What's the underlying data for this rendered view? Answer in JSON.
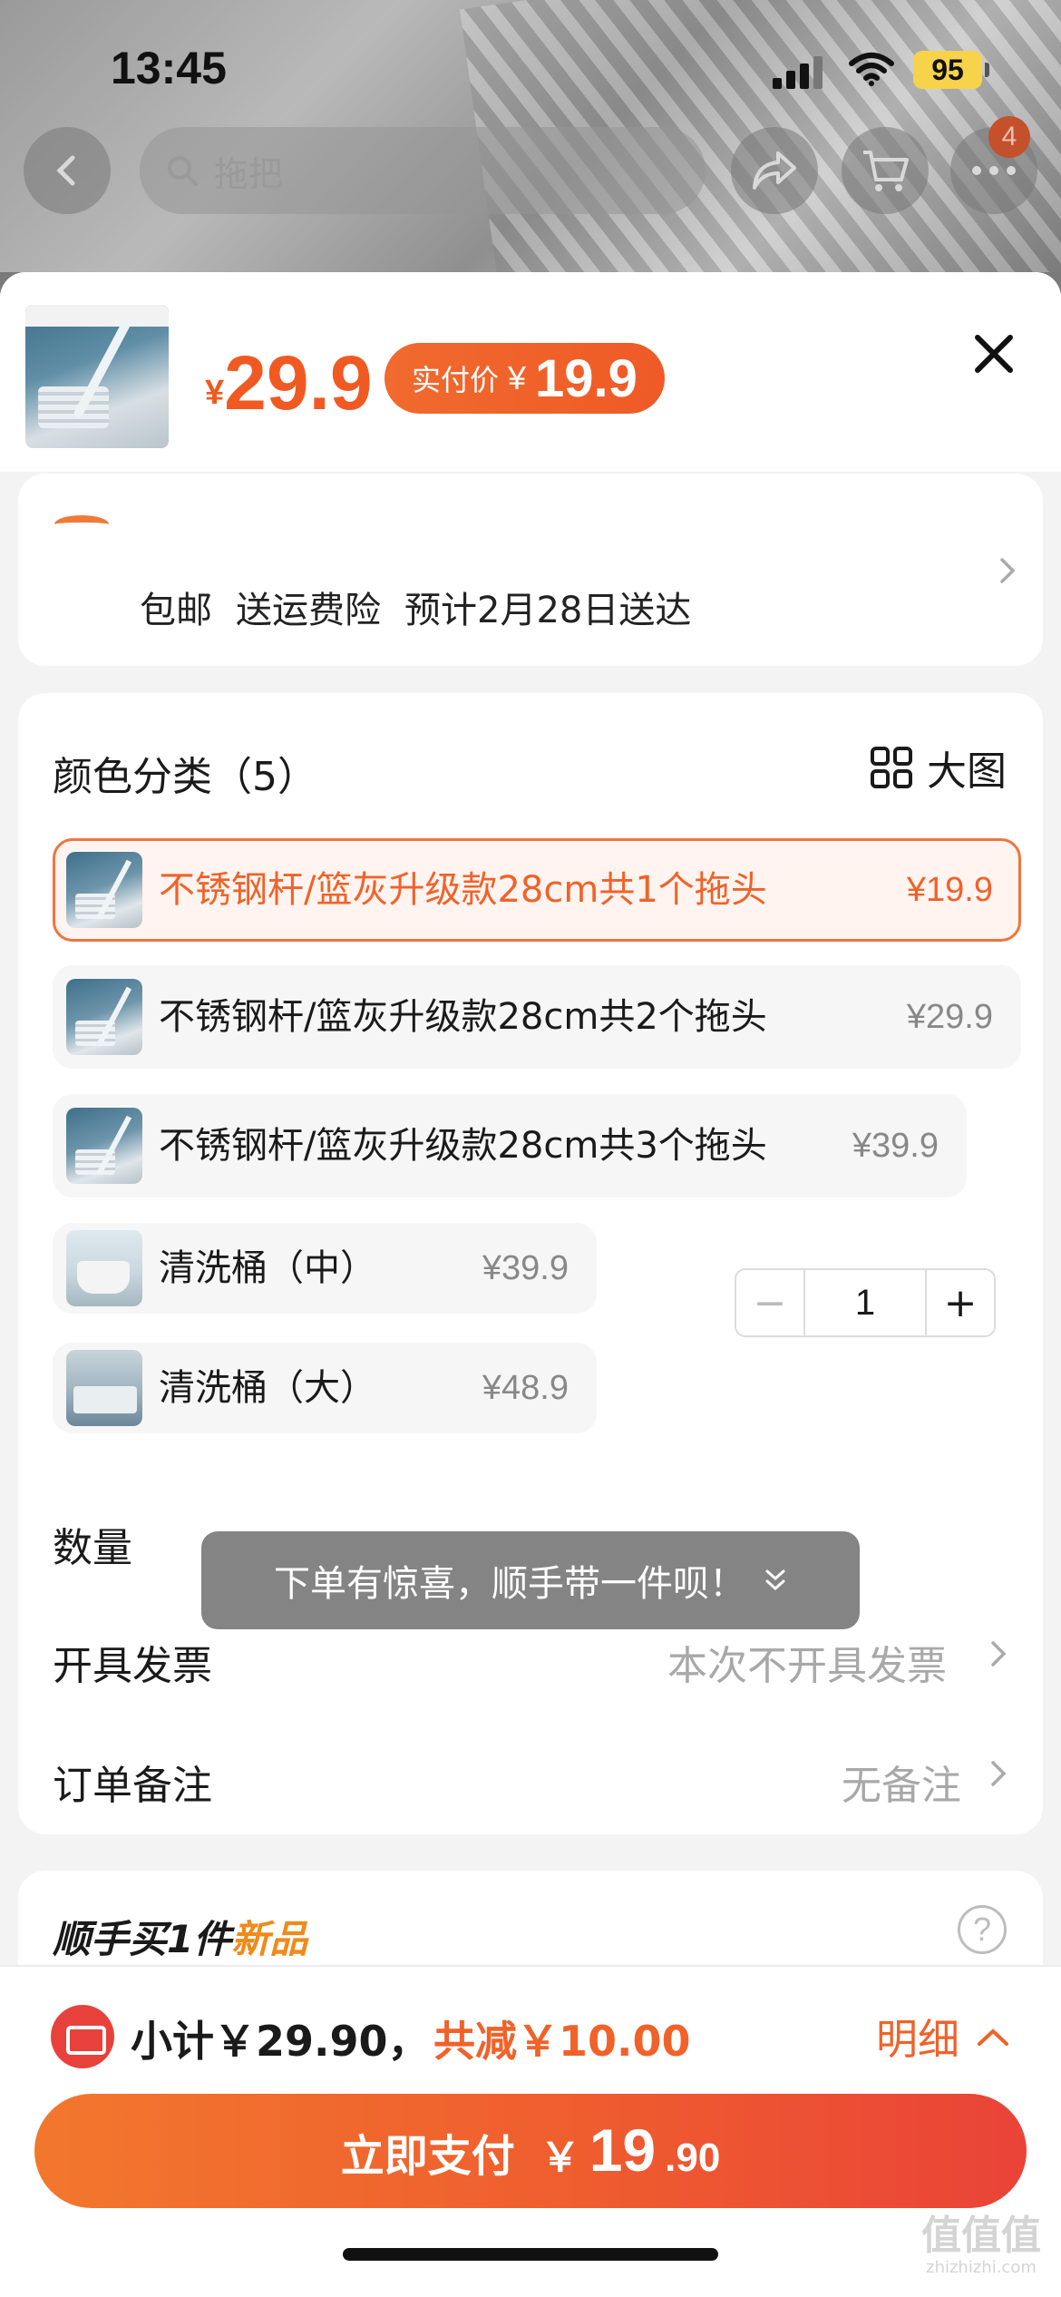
{
  "status_bar": {
    "time": "13:45",
    "battery": "95"
  },
  "background": {
    "search_placeholder": "拖把",
    "cart_badge": "4"
  },
  "product": {
    "price_symbol": "¥",
    "price": "29.9",
    "paid_label": "实付价",
    "paid_symbol": "¥",
    "paid_price": "19.9"
  },
  "delivery": {
    "tags": [
      "包邮",
      "送运费险",
      "预计2月28日送达"
    ]
  },
  "options": {
    "title": "颜色分类（5）",
    "big_picture": "大图",
    "items": [
      {
        "label": "不锈钢杆/篮灰升级款28cm共1个拖头",
        "price": "¥19.9",
        "selected": true
      },
      {
        "label": "不锈钢杆/篮灰升级款28cm共2个拖头",
        "price": "¥29.9",
        "selected": false
      },
      {
        "label": "不锈钢杆/篮灰升级款28cm共3个拖头",
        "price": "¥39.9",
        "selected": false
      },
      {
        "label": "清洗桶（中）",
        "price": "¥39.9",
        "selected": false
      },
      {
        "label": "清洗桶（大）",
        "price": "¥48.9",
        "selected": false
      }
    ]
  },
  "quantity": {
    "label": "数量",
    "minus": "−",
    "value": "1",
    "plus": "+"
  },
  "invoice": {
    "label": "开具发票",
    "value": "本次不开具发票"
  },
  "note": {
    "label": "订单备注",
    "value": "无备注"
  },
  "toast": {
    "text": "下单有惊喜，顺手带一件呗！",
    "arrow": "≫"
  },
  "addon": {
    "title_prefix": "顺手买1件",
    "title_highlight": "新品",
    "help": "?"
  },
  "summary": {
    "subtotal": "小计￥29.90，",
    "discount": "共减￥10.00",
    "detail": "明细"
  },
  "pay_button": {
    "label": "立即支付",
    "symbol": "￥",
    "integer": "19",
    "decimal": ".90"
  },
  "watermark": {
    "line1": "值值值",
    "line2": "zhizhizhi.com"
  },
  "colors": {
    "accent": "#f0622a",
    "pay_gradient_end": "#ea4338",
    "badge": "#e8413c"
  }
}
